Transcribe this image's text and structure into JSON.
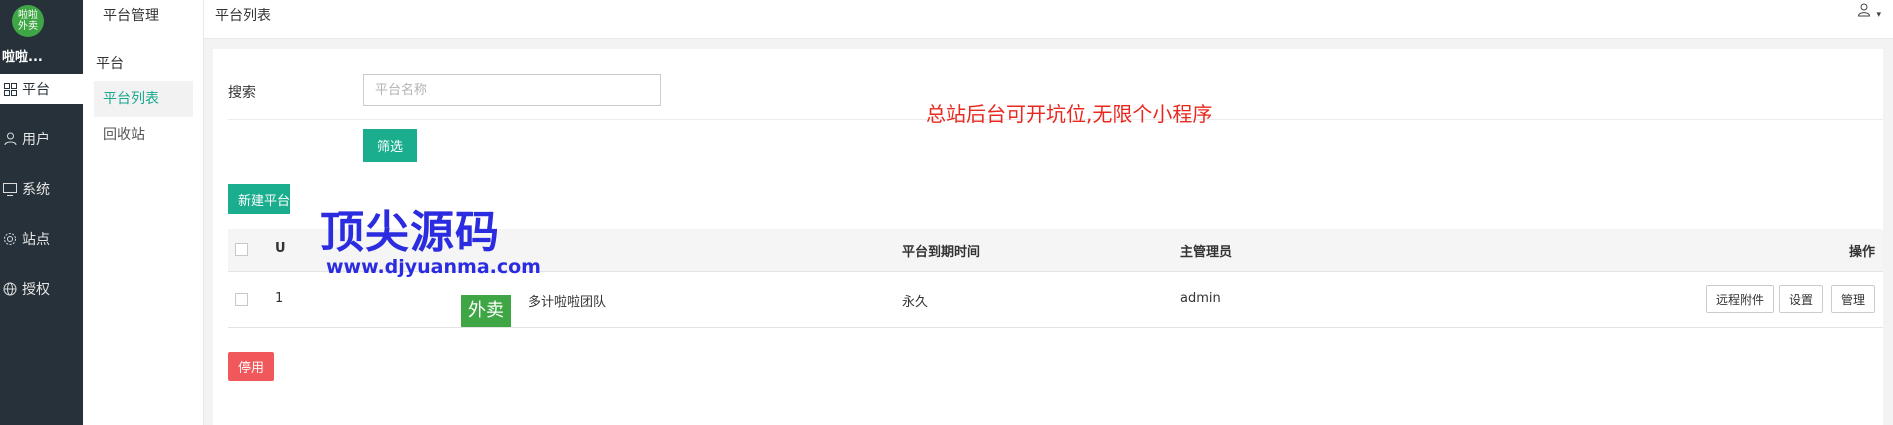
{
  "brand": {
    "logo_text": "啦啦\n外卖",
    "name": "啦啦..."
  },
  "sidebar": {
    "items": [
      {
        "label": "平台",
        "icon": "grid-icon",
        "active": true
      },
      {
        "label": "用户",
        "icon": "user-icon",
        "active": false
      },
      {
        "label": "系统",
        "icon": "monitor-icon",
        "active": false
      },
      {
        "label": "站点",
        "icon": "gear-icon",
        "active": false
      },
      {
        "label": "授权",
        "icon": "globe-icon",
        "active": false
      }
    ]
  },
  "subnav": {
    "header": "平台管理",
    "group": "平台",
    "links": [
      {
        "label": "平台列表",
        "active": true
      },
      {
        "label": "回收站",
        "active": false
      }
    ]
  },
  "topbar": {
    "breadcrumb": "平台列表",
    "user_icon": "user-icon"
  },
  "search": {
    "label": "搜索",
    "placeholder": "平台名称",
    "filter_button": "筛选"
  },
  "promo_text": "总站后台可开坑位,无限个小程序",
  "new_button": "新建平台",
  "table": {
    "headers": {
      "id": "U",
      "expire": "平台到期时间",
      "admin": "主管理员",
      "actions": "操作"
    },
    "rows": [
      {
        "id": "1",
        "name": "多计啦啦团队",
        "expire": "永久",
        "admin": "admin"
      }
    ],
    "row_actions": [
      "远程附件",
      "设置",
      "管理"
    ]
  },
  "disable_button": "停用",
  "watermark": {
    "title": "顶尖源码",
    "url": "www.djyuanma.com",
    "badge": "外卖"
  },
  "colors": {
    "sidebar_bg": "#263139",
    "primary": "#1aae8e",
    "danger": "#f0585b",
    "promo": "#e8281e",
    "watermark": "#2b2ce0"
  }
}
